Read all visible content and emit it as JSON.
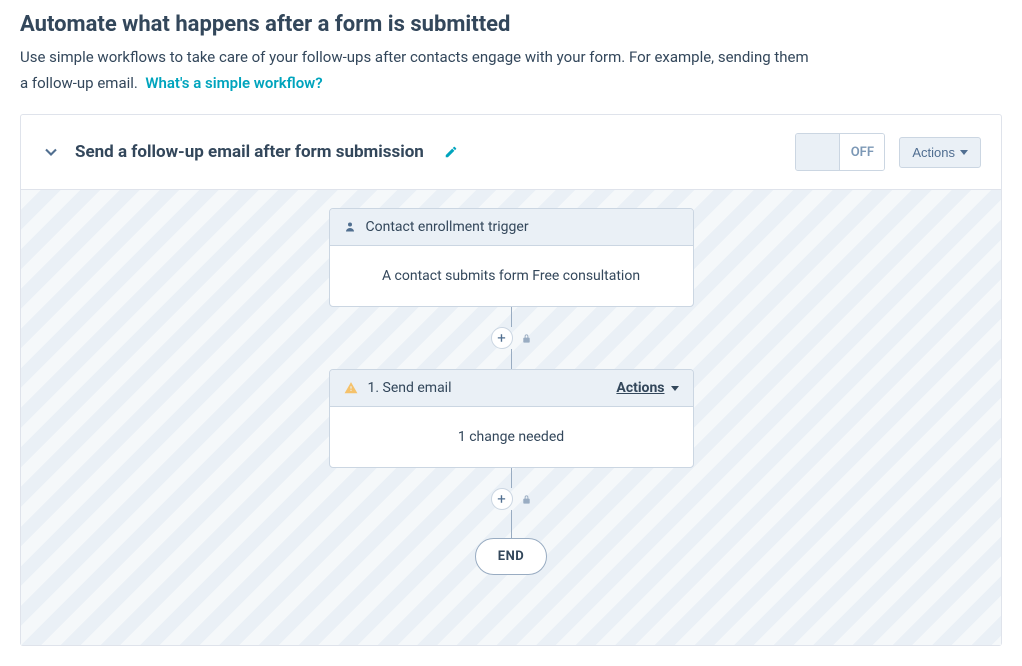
{
  "header": {
    "title": "Automate what happens after a form is submitted",
    "description": "Use simple workflows to take care of your follow-ups after contacts engage with your form. For example, sending them a follow-up email.",
    "link_text": "What's a simple workflow?"
  },
  "workflow": {
    "name": "Send a follow-up email after form submission",
    "toggle": {
      "on_label": "",
      "off_label": "OFF"
    },
    "actions_label": "Actions"
  },
  "flow": {
    "trigger": {
      "head": "Contact enrollment trigger",
      "body": "A contact submits form Free consultation"
    },
    "step1": {
      "head": "1. Send email",
      "actions_label": "Actions",
      "body": "1 change needed"
    },
    "end_label": "END"
  }
}
